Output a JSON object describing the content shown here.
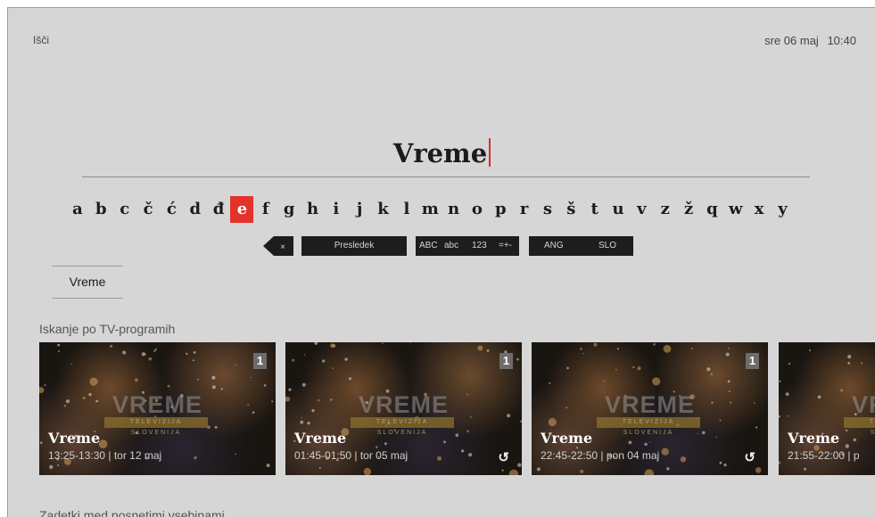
{
  "header": {
    "title": "Išči",
    "date": "sre 06 maj",
    "time": "10:40"
  },
  "search": {
    "query": "Vreme"
  },
  "keyboard": {
    "letters": [
      "a",
      "b",
      "c",
      "č",
      "ć",
      "d",
      "đ",
      "e",
      "f",
      "g",
      "h",
      "i",
      "j",
      "k",
      "l",
      "m",
      "n",
      "o",
      "p",
      "r",
      "s",
      "š",
      "t",
      "u",
      "v",
      "z",
      "ž",
      "q",
      "w",
      "x",
      "y"
    ],
    "active_letter": "e",
    "backspace_symbol": "×",
    "space_label": "Presledek",
    "modes": [
      "ABC",
      "abc",
      "123",
      "=+-"
    ],
    "languages": [
      "ANG",
      "SLO"
    ]
  },
  "suggestions": [
    "Vreme"
  ],
  "sections": {
    "tv_programs": "Iskanje po TV-programih",
    "recorded": "Zadetki med posnetimi vsebinami"
  },
  "tiles": [
    {
      "title": "Vreme",
      "time": "13:25-13:30 | tor 12 maj",
      "badge": "1",
      "logo": "VREME",
      "strip": "TELEVIZIJA SLOVENIJA",
      "replay": false
    },
    {
      "title": "Vreme",
      "time": "01:45-01:50 | tor 05 maj",
      "badge": "1",
      "logo": "VREME",
      "strip": "TELEVIZIJA SLOVENIJA",
      "replay": true
    },
    {
      "title": "Vreme",
      "time": "22:45-22:50 | pon 04 maj",
      "badge": "1",
      "logo": "VREME",
      "strip": "TELEVIZIJA SLOVENIJA",
      "replay": true
    },
    {
      "title": "Vreme",
      "time": "21:55-22:00 | p",
      "badge": "",
      "logo": "VREME",
      "strip": "TELEVIZIJA SLOVENIJA",
      "replay": false
    }
  ],
  "colors": {
    "accent": "#e4322b",
    "background": "#d6d6d6",
    "key_bar": "#1d1d1d"
  }
}
